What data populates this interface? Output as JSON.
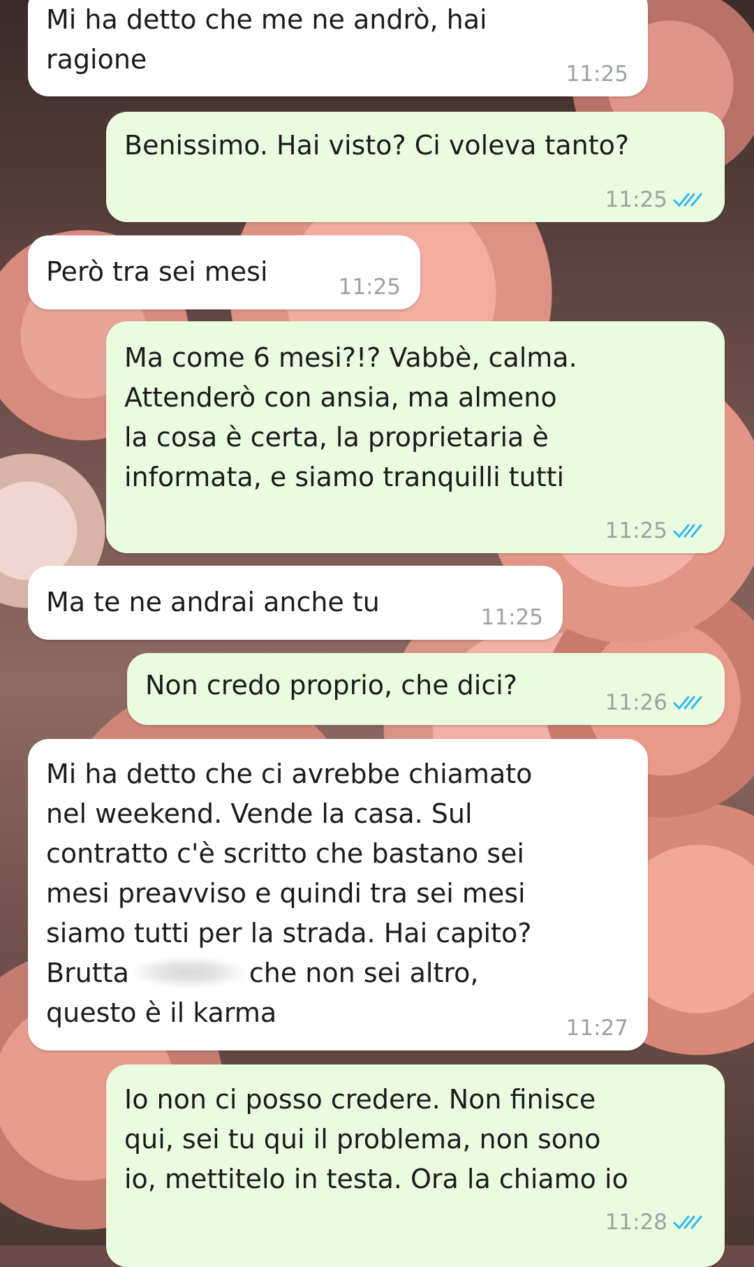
{
  "messages": [
    {
      "direction": "in",
      "text": "Mi ha detto che me ne andrò, hai\nragione",
      "time": "11:25"
    },
    {
      "direction": "out",
      "text": "Benissimo. Hai visto? Ci voleva tanto?",
      "time": "11:25",
      "status": "read"
    },
    {
      "direction": "in",
      "text": "Però tra sei mesi",
      "time": "11:25"
    },
    {
      "direction": "out",
      "text": "Ma come 6 mesi?!? Vabbè, calma.\nAttenderò con ansia, ma almeno\nla cosa è certa, la proprietaria è\ninformata, e siamo tranquilli tutti",
      "time": "11:25",
      "status": "read"
    },
    {
      "direction": "in",
      "text": "Ma te ne andrai anche tu",
      "time": "11:25"
    },
    {
      "direction": "out",
      "text": "Non credo proprio, che dici?",
      "time": "11:26",
      "status": "read"
    },
    {
      "direction": "in",
      "text_part1": "Mi ha detto che ci avrebbe chiamato\nnel weekend. Vende la casa. Sul\ncontratto c'è scritto che bastano sei\nmesi preavviso e quindi tra sei mesi\nsiamo tutti per la strada. Hai capito?\nBrutta",
      "text_part2": "che non sei altro,\nquesto è il karma",
      "time": "11:27"
    },
    {
      "direction": "out",
      "text": "Io non ci posso credere. Non finisce\nqui, sei tu qui il problema, non sono\nio, mettitelo in testa. Ora la chiamo io",
      "time": "11:28",
      "status": "read"
    }
  ],
  "colors": {
    "incoming_bubble": "#ffffff",
    "outgoing_bubble": "#eafce0",
    "timestamp": "#9aa3a0",
    "read_ticks": "#34b7f1"
  },
  "icons": {
    "read_receipt": "double-check-icon"
  }
}
